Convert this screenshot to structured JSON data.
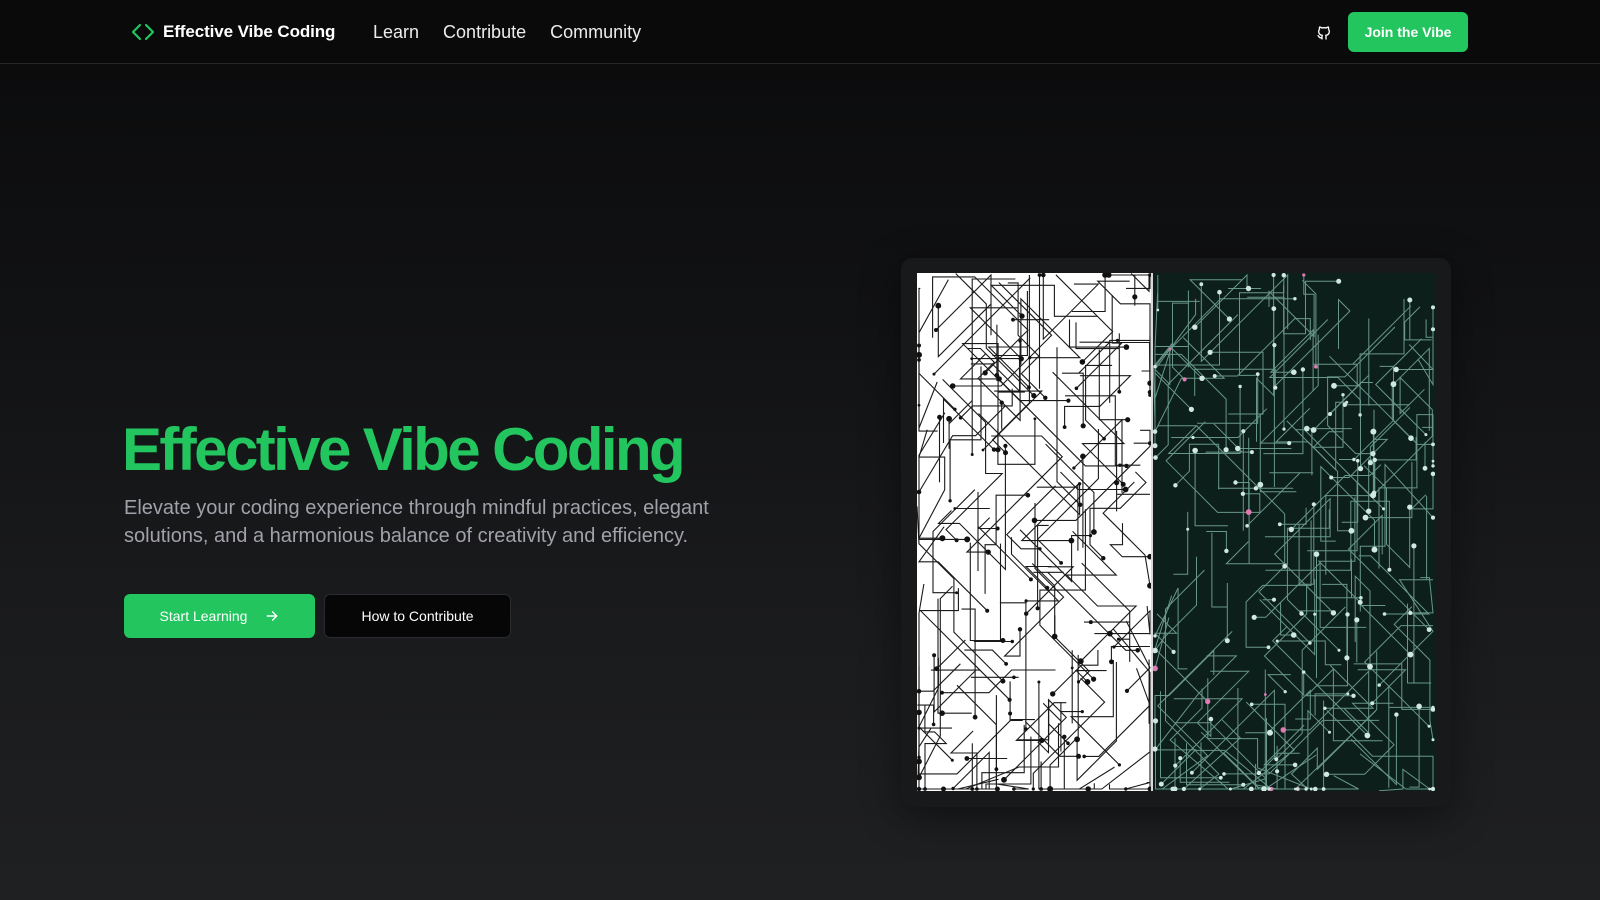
{
  "brand": {
    "name": "Effective Vibe Coding",
    "icon": "code-brackets-icon",
    "accent": "#22c55e"
  },
  "nav": {
    "links": [
      {
        "label": "Learn"
      },
      {
        "label": "Contribute"
      },
      {
        "label": "Community"
      }
    ],
    "github_icon": "github-icon",
    "join_label": "Join the Vibe"
  },
  "hero": {
    "title": "Effective Vibe Coding",
    "subtitle": "Elevate your coding experience through mindful practices, elegant solutions, and a harmonious balance of creativity and efficiency.",
    "primary_label": "Start Learning",
    "primary_icon": "arrow-right-icon",
    "secondary_label": "How to Contribute"
  },
  "image": {
    "description_icon": "circuit-board-illustration"
  },
  "colors": {
    "accent": "#22c55e",
    "background": "#0b0b0c",
    "muted_text": "#a1a1aa",
    "circuit_dark": "#0d1f1b",
    "circuit_light": "#ffffff"
  }
}
